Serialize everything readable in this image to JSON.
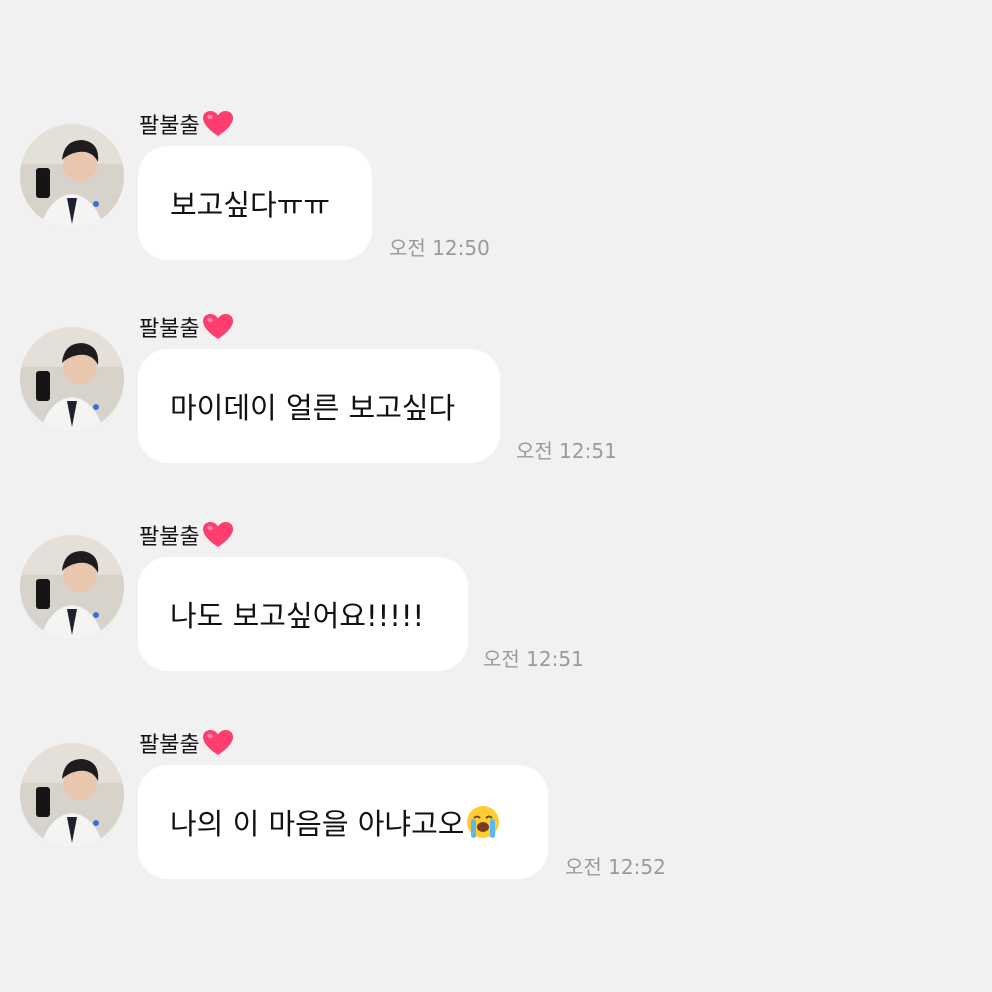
{
  "messages": [
    {
      "sender": "팔불출",
      "text": "보고싶다ㅠㅠ",
      "time": "오전 12:50"
    },
    {
      "sender": "팔불출",
      "text": "마이데이 얼른 보고싶다",
      "time": "오전 12:51"
    },
    {
      "sender": "팔불출",
      "text": "나도 보고싶어요!!!!!",
      "time": "오전 12:51"
    },
    {
      "sender": "팔불출",
      "text": "나의 이 마음을 아냐고오",
      "time": "오전 12:52",
      "emoji": "loudly-crying-face-icon"
    }
  ],
  "sender_badge": "red-heart-icon",
  "colors": {
    "background": "#f1f1f1",
    "bubble": "#ffffff",
    "heart": "#ff3d6e",
    "time": "#9a9a9a"
  }
}
